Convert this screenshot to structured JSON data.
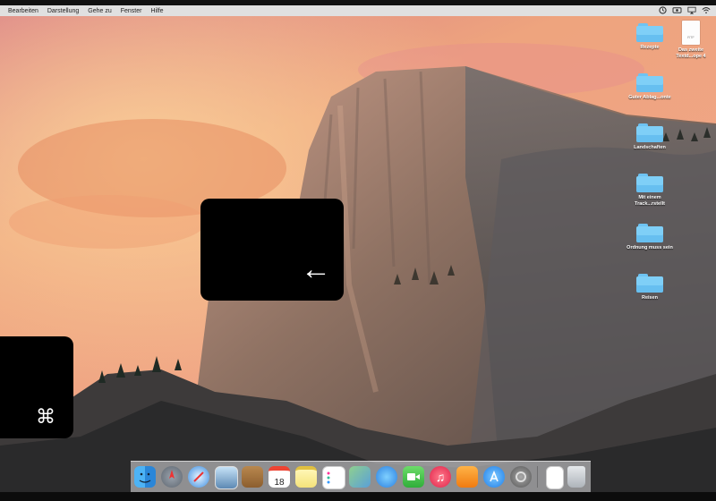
{
  "menubar": {
    "items": [
      "Bearbeiten",
      "Darstellung",
      "Gehe zu",
      "Fenster",
      "Hilfe"
    ],
    "status_icons": [
      "time-machine-icon",
      "screen-recorder-icon",
      "airplay-icon",
      "wifi-icon"
    ]
  },
  "desktop": {
    "wallpaper": "yosemite-half-dome",
    "icons": [
      {
        "label": "Rezepte",
        "type": "folder"
      },
      {
        "label": "Das zweite Textd...ope 4",
        "type": "rtf",
        "badge": "RTF"
      },
      {
        "label": "Guter Ablag...onte",
        "type": "folder"
      },
      {
        "label": "Landschaften",
        "type": "folder"
      },
      {
        "label": "Mit einem Track...rstellt",
        "type": "folder"
      },
      {
        "label": "Ordnung muss sein",
        "type": "folder"
      },
      {
        "label": "Reisen",
        "type": "folder"
      }
    ]
  },
  "keystroke_overlay": {
    "keys": [
      {
        "glyph": "⌘",
        "name": "command-key"
      },
      {
        "glyph": "←",
        "name": "left-arrow-key"
      }
    ]
  },
  "dock": {
    "apps": [
      {
        "name": "finder",
        "icon": "finder-icon"
      },
      {
        "name": "launchpad",
        "icon": "launchpad-icon"
      },
      {
        "name": "safari",
        "icon": "safari-icon"
      },
      {
        "name": "preview",
        "icon": "preview-icon"
      },
      {
        "name": "contacts",
        "icon": "contacts-icon"
      },
      {
        "name": "calendar",
        "icon": "calendar-icon",
        "text": "18"
      },
      {
        "name": "notes",
        "icon": "notes-icon"
      },
      {
        "name": "reminders",
        "icon": "reminders-icon"
      },
      {
        "name": "photos",
        "icon": "photos-icon"
      },
      {
        "name": "messages",
        "icon": "messages-icon"
      },
      {
        "name": "facetime",
        "icon": "facetime-icon"
      },
      {
        "name": "itunes",
        "icon": "itunes-icon"
      },
      {
        "name": "ibooks",
        "icon": "ibooks-icon"
      },
      {
        "name": "app-store",
        "icon": "app-store-icon"
      },
      {
        "name": "system-preferences",
        "icon": "system-preferences-icon"
      },
      {
        "name": "document",
        "icon": "document-icon"
      },
      {
        "name": "trash",
        "icon": "trash-icon"
      }
    ]
  }
}
